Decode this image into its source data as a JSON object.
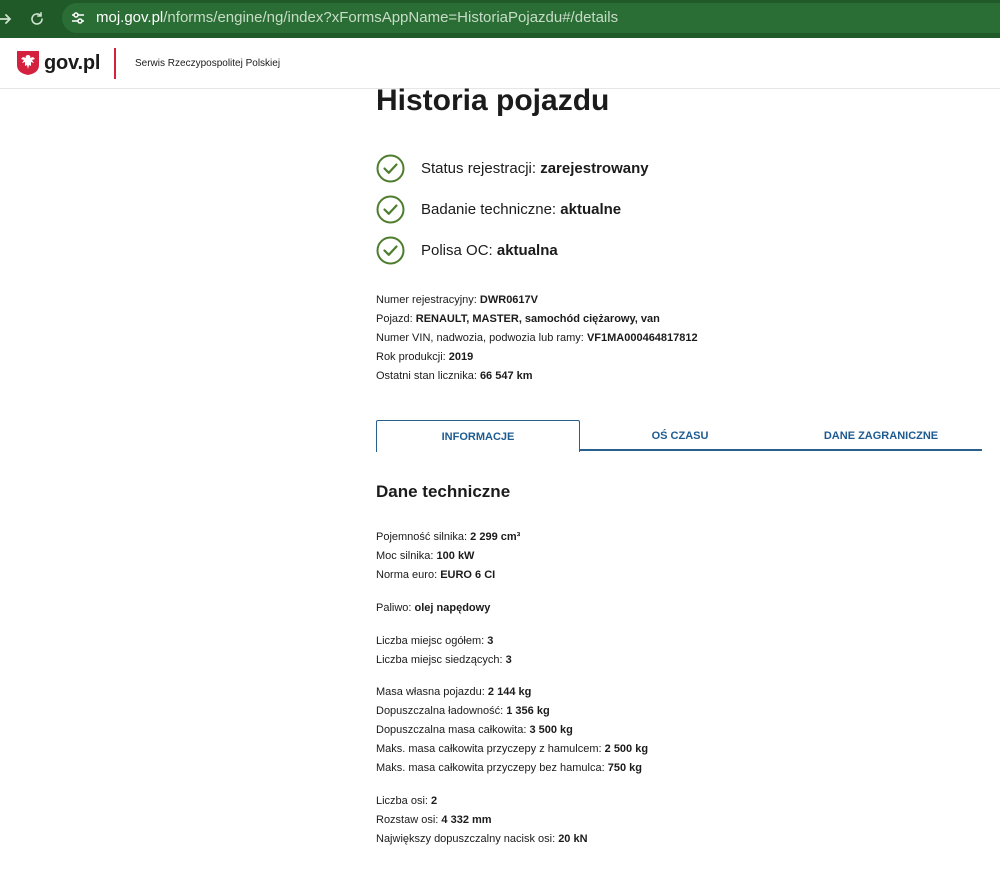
{
  "browser": {
    "url_host": "moj.gov.pl",
    "url_path": "/nforms/engine/ng/index?xFormsAppName=HistoriaPojazdu#/details"
  },
  "header": {
    "logo_text": "gov.pl",
    "service_name": "Serwis Rzeczypospolitej Polskiej"
  },
  "page": {
    "title": "Historia pojazdu"
  },
  "statuses": [
    {
      "label": "Status rejestracji: ",
      "value": "zarejestrowany"
    },
    {
      "label": "Badanie techniczne: ",
      "value": "aktualne"
    },
    {
      "label": "Polisa OC: ",
      "value": "aktualna"
    }
  ],
  "vehicle": [
    {
      "label": "Numer rejestracyjny: ",
      "value": "DWR0617V"
    },
    {
      "label": "Pojazd: ",
      "value": "RENAULT, MASTER, samochód ciężarowy, van"
    },
    {
      "label": "Numer VIN, nadwozia, podwozia lub ramy: ",
      "value": "VF1MA000464817812"
    },
    {
      "label": "Rok produkcji: ",
      "value": "2019"
    },
    {
      "label": "Ostatni stan licznika: ",
      "value": "66 547 km"
    }
  ],
  "tabs": [
    {
      "label": "INFORMACJE"
    },
    {
      "label": "OŚ CZASU"
    },
    {
      "label": "DANE ZAGRANICZNE"
    }
  ],
  "technical": {
    "title": "Dane techniczne",
    "engine": [
      {
        "label": "Pojemność silnika: ",
        "value": "2 299 cm³"
      },
      {
        "label": "Moc silnika: ",
        "value": "100 kW"
      },
      {
        "label": "Norma euro: ",
        "value": "EURO 6 CI"
      }
    ],
    "fuel": [
      {
        "label": "Paliwo: ",
        "value": "olej napędowy"
      }
    ],
    "seats": [
      {
        "label": "Liczba miejsc ogółem: ",
        "value": "3"
      },
      {
        "label": "Liczba miejsc siedzących: ",
        "value": "3"
      }
    ],
    "mass": [
      {
        "label": "Masa własna pojazdu: ",
        "value": "2 144 kg"
      },
      {
        "label": "Dopuszczalna ładowność: ",
        "value": "1 356 kg"
      },
      {
        "label": "Dopuszczalna masa całkowita: ",
        "value": "3 500 kg"
      },
      {
        "label": "Maks. masa całkowita przyczepy z hamulcem: ",
        "value": "2 500 kg"
      },
      {
        "label": "Maks. masa całkowita przyczepy bez hamulca: ",
        "value": "750 kg"
      }
    ],
    "axles": [
      {
        "label": "Liczba osi: ",
        "value": "2"
      },
      {
        "label": "Rozstaw osi: ",
        "value": "4 332 mm"
      },
      {
        "label": "Największy dopuszczalny nacisk osi: ",
        "value": "20 kN"
      }
    ]
  },
  "icons": {
    "check": "check-circle-icon",
    "back": "arrow-right-icon",
    "reload": "reload-icon",
    "site_settings": "tune-icon"
  },
  "colors": {
    "browser_bar": "#1f5a28",
    "check_green": "#4e7d2e",
    "tab_blue": "#1d5b91",
    "header_accent": "#d4213d"
  }
}
